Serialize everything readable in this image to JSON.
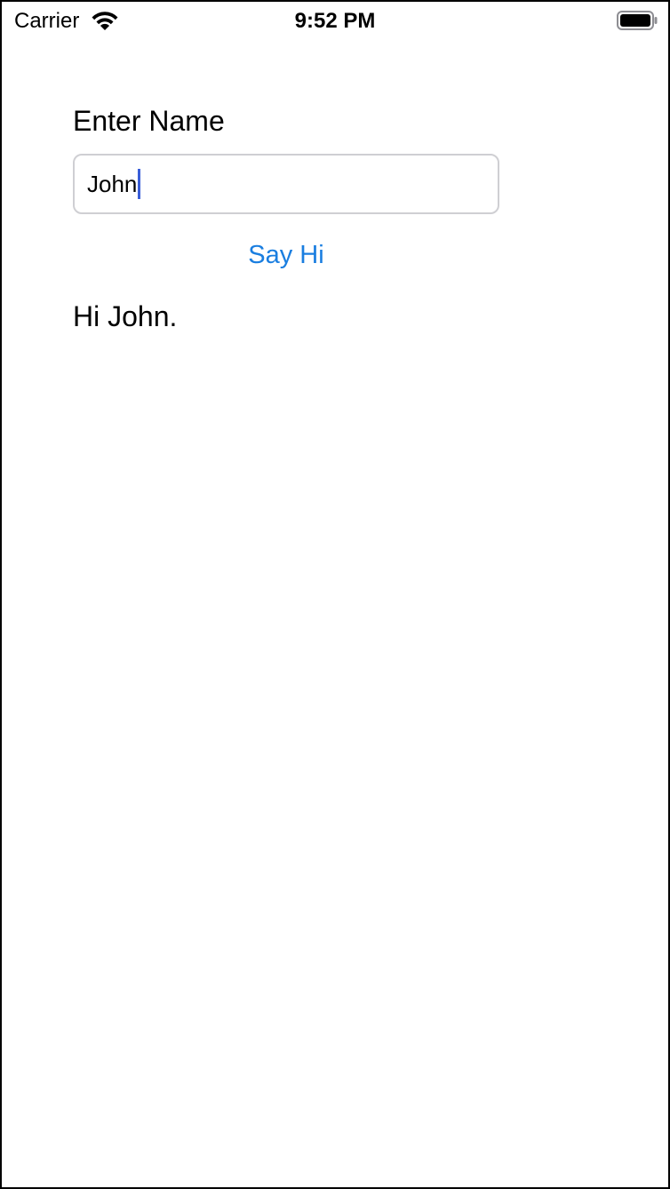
{
  "status_bar": {
    "carrier": "Carrier",
    "time": "9:52 PM",
    "wifi_icon": "wifi-icon",
    "battery_icon": "battery-icon"
  },
  "form": {
    "label": "Enter Name",
    "name_value": "John",
    "button_label": "Say Hi",
    "greeting": "Hi John."
  },
  "colors": {
    "accent": "#1a7ee0",
    "caret": "#3a5ed8",
    "field_border": "#cfcfd3"
  }
}
